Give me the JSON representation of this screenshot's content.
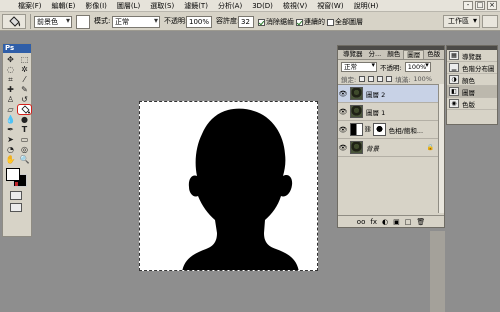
{
  "menu": [
    "檔案(F)",
    "編輯(E)",
    "影像(I)",
    "圖層(L)",
    "選取(S)",
    "濾鏡(T)",
    "分析(A)",
    "3D(D)",
    "檢視(V)",
    "視窗(W)",
    "說明(H)"
  ],
  "window_buttons": [
    "-",
    "□",
    "×"
  ],
  "options": {
    "fill_source": "前景色",
    "mode_label": "模式:",
    "mode_value": "正常",
    "opacity_label": "不透明:",
    "opacity_value": "100%",
    "tolerance_label": "容許度:",
    "tolerance_value": "32",
    "antialias": "消除鋸齒",
    "contiguous": "連續的",
    "all_layers": "全部圖層",
    "workspace": "工作區"
  },
  "toolbox": {
    "title": "Ps"
  },
  "layers_panel": {
    "tabs": [
      "導覽器",
      "分...",
      "顏色",
      "圖層",
      "色版",
      "路徑"
    ],
    "blend_mode": "正常",
    "opacity_label": "不透明:",
    "opacity_value": "100%",
    "lock_label": "鎖定:",
    "fill_label": "填滿:",
    "fill_value": "100%",
    "layers": [
      {
        "name": "圖層 2",
        "selected": true
      },
      {
        "name": "圖層 1",
        "selected": false
      },
      {
        "name": "色相/飽和...",
        "selected": false
      },
      {
        "name": "背景",
        "selected": false
      }
    ],
    "bottom_icons": [
      "oo",
      "fx",
      "◐",
      "▣",
      "□",
      "🗑"
    ]
  },
  "dock": {
    "items": [
      {
        "label": "導覽器",
        "icon": "navigator-icon"
      },
      {
        "label": "色階分布圖",
        "icon": "histogram-icon"
      },
      {
        "label": "顏色",
        "icon": "color-icon"
      },
      {
        "label": "圖層",
        "icon": "layers-icon"
      },
      {
        "label": "色版",
        "icon": "channels-icon"
      }
    ]
  },
  "colors": {
    "foreground": "#ffffff",
    "background": "#000000",
    "highlight": "#d3201a",
    "toolbox_header": "#2f5ea8"
  }
}
